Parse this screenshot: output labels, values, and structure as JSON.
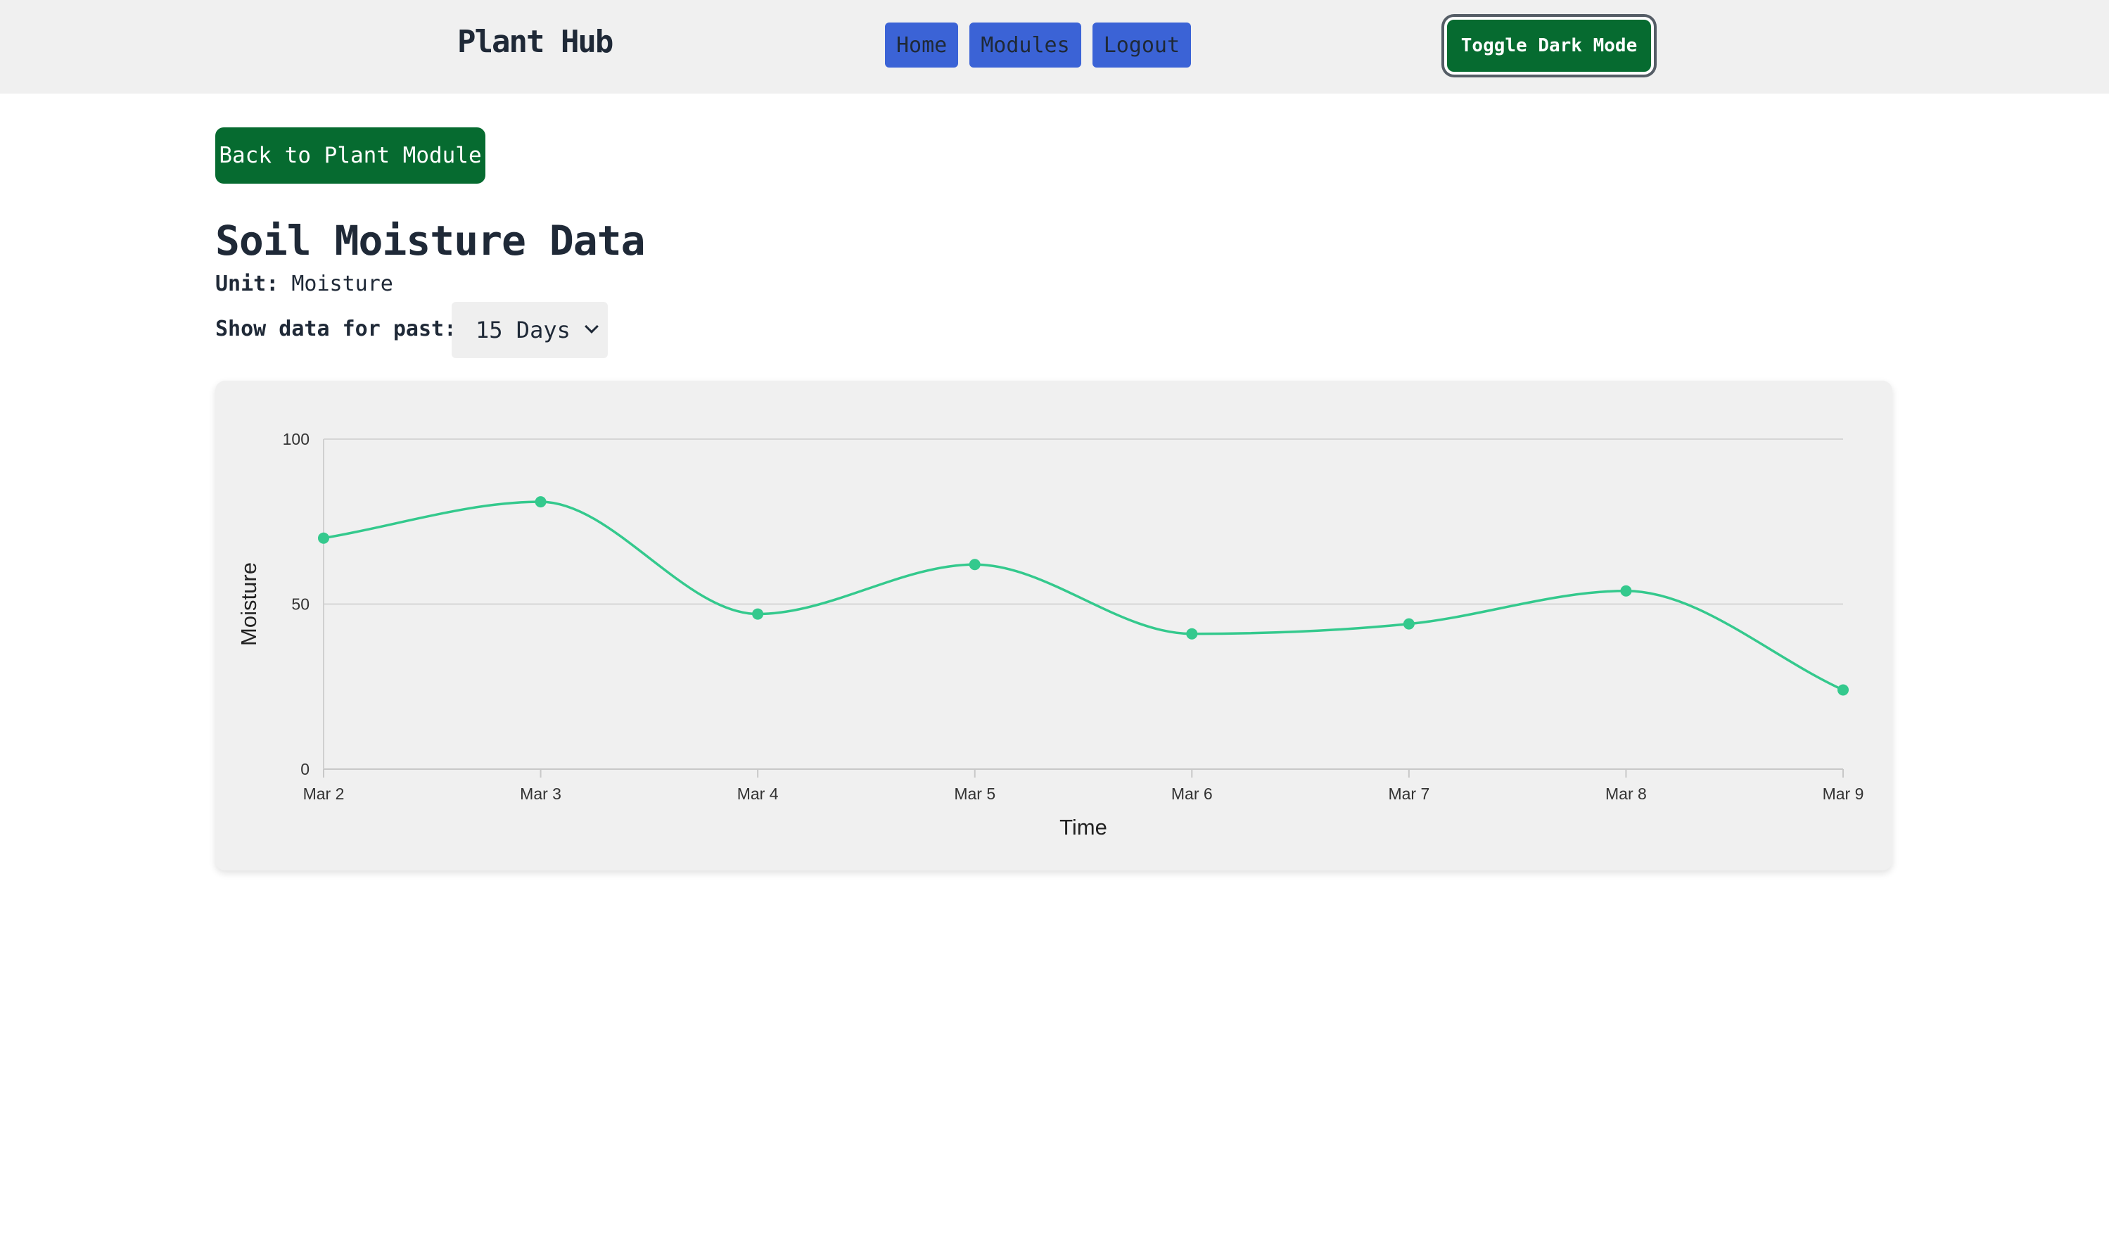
{
  "navbar": {
    "brand": "Plant Hub",
    "links": [
      "Home",
      "Modules",
      "Logout"
    ],
    "toggle_label": "Toggle Dark Mode"
  },
  "page": {
    "back_label": "Back to Plant Module",
    "title": "Soil Moisture Data",
    "unit_label": "Unit:",
    "unit_value": "Moisture",
    "range_label": "Show data for past:",
    "range_selected": "15 Days"
  },
  "colors": {
    "line": "#34c98d",
    "brand_green": "#066b30",
    "nav_blue": "#3b63d6"
  },
  "chart_data": {
    "type": "line",
    "x": [
      "Mar 2",
      "Mar 3",
      "Mar 4",
      "Mar 5",
      "Mar 6",
      "Mar 7",
      "Mar 8",
      "Mar 9"
    ],
    "series": [
      {
        "values": [
          70,
          81,
          47,
          62,
          41,
          44,
          54,
          24
        ]
      }
    ],
    "xlabel": "Time",
    "ylabel": "Moisture",
    "ylim": [
      0,
      100
    ],
    "yticks": [
      "0",
      "50",
      "100"
    ],
    "grid": true,
    "curve": "smooth"
  }
}
